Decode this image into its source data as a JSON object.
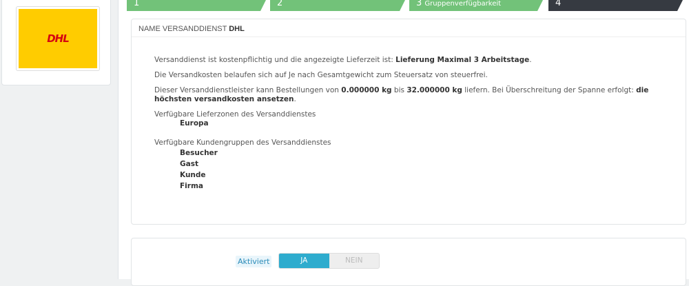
{
  "logo": {
    "text": "DHL"
  },
  "steps": [
    {
      "num": "1",
      "label": ""
    },
    {
      "num": "2",
      "label": ""
    },
    {
      "num": "3",
      "label": "Gruppenverfügbarkeit"
    },
    {
      "num": "4",
      "label": ""
    }
  ],
  "summary": {
    "title_prefix": "Name Versanddienst",
    "title_name": "DHL",
    "line1_pre": "Versanddienst ist kostenpflichtig und die angezeigte Lieferzeit ist: ",
    "line1_val": "Lieferung Maximal 3 Arbeitstage",
    "line1_post": ".",
    "line2": "Die Versandkosten belaufen sich auf Je nach Gesamtgewicht zum Steuersatz von steuerfrei.",
    "line3_a": "Dieser Versanddienstleister kann Bestellungen von ",
    "line3_min": "0.000000 kg",
    "line3_b": " bis ",
    "line3_max": "32.000000 kg",
    "line3_c": " liefern. Bei Überschreitung der Spanne erfolgt: ",
    "line3_action": "die höchsten versandkosten ansetzen",
    "line3_d": ".",
    "zones_label": "Verfügbare Lieferzonen des Versanddienstes",
    "zones": [
      "Europa"
    ],
    "groups_label": "Verfügbare Kundengruppen des Versanddienstes",
    "groups": [
      "Besucher",
      "Gast",
      "Kunde",
      "Firma"
    ]
  },
  "activation": {
    "label": "Aktiviert",
    "yes": "JA",
    "no": "NEIN",
    "value": "JA"
  }
}
